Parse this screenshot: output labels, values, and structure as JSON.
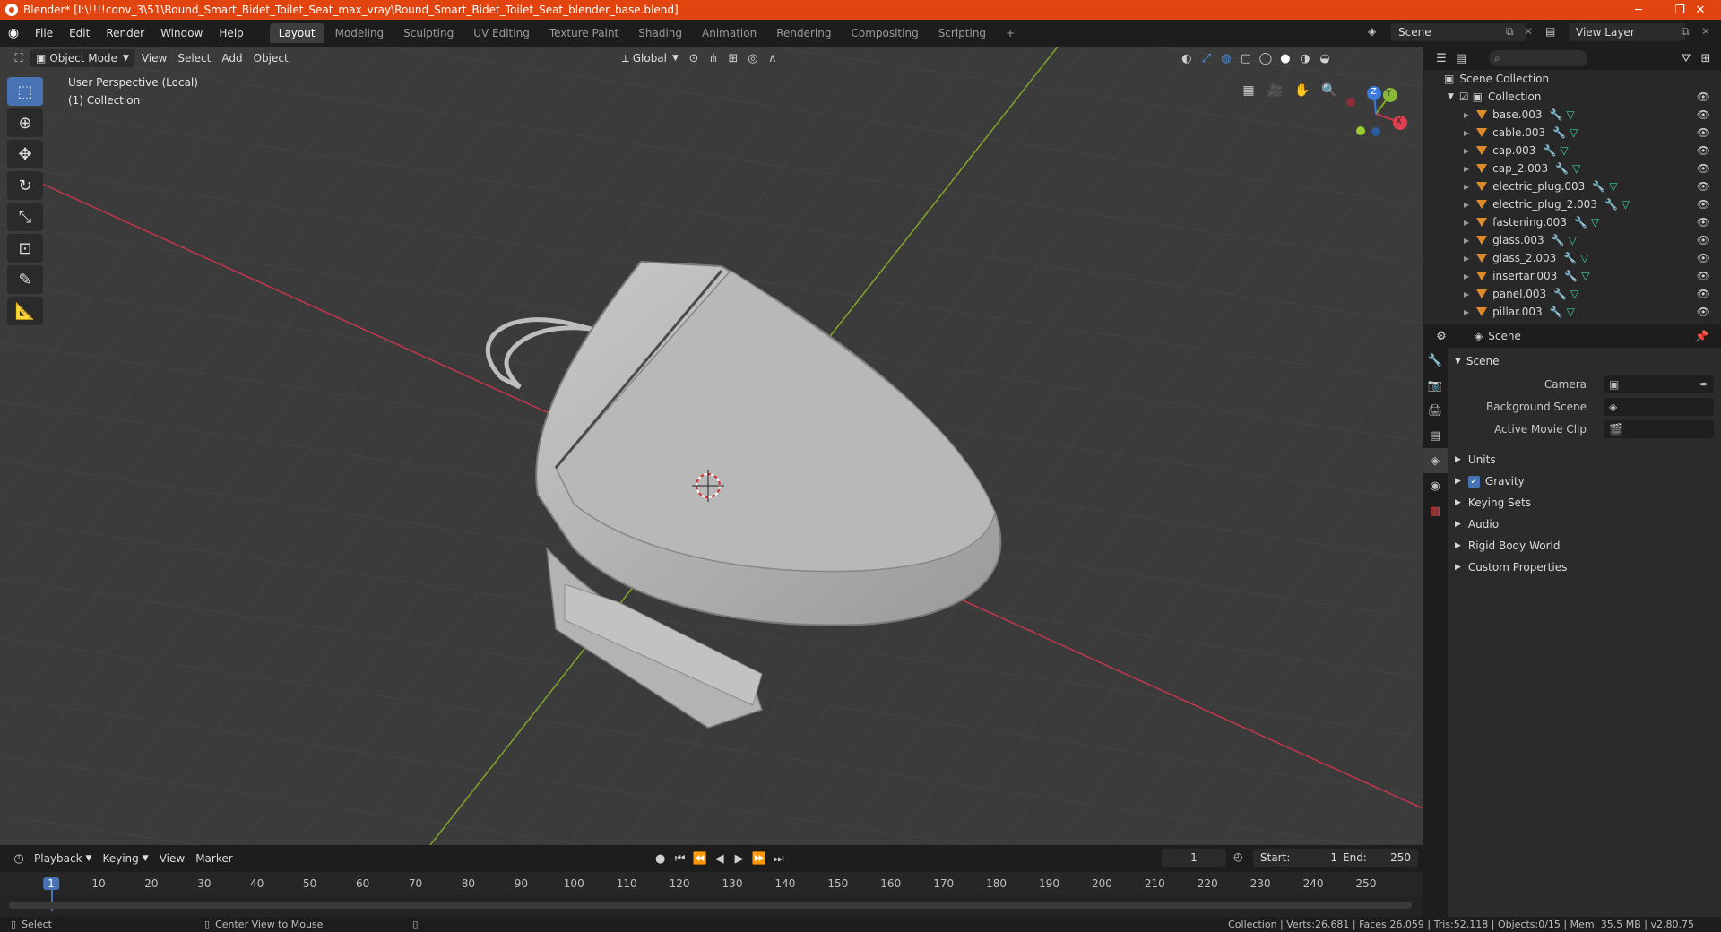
{
  "titlebar": {
    "title": "Blender* [I:\\!!!!conv_3\\51\\Round_Smart_Bidet_Toilet_Seat_max_vray\\Round_Smart_Bidet_Toilet_Seat_blender_base.blend]",
    "minimize": "─",
    "maximize": "❐",
    "close": "✕"
  },
  "menu": [
    "File",
    "Edit",
    "Render",
    "Window",
    "Help"
  ],
  "workspaces": [
    {
      "label": "Layout",
      "active": true
    },
    {
      "label": "Modeling"
    },
    {
      "label": "Sculpting"
    },
    {
      "label": "UV Editing"
    },
    {
      "label": "Texture Paint"
    },
    {
      "label": "Shading"
    },
    {
      "label": "Animation"
    },
    {
      "label": "Rendering"
    },
    {
      "label": "Compositing"
    },
    {
      "label": "Scripting"
    }
  ],
  "add_workspace": "+",
  "scene": {
    "name": "Scene"
  },
  "view_layer": {
    "name": "View Layer"
  },
  "viewport": {
    "mode": "Object Mode",
    "menus": [
      "View",
      "Select",
      "Add",
      "Object"
    ],
    "transform_orientation": "Global",
    "info_line1": "User Perspective (Local)",
    "info_line2": "(1) Collection",
    "gizmo": {
      "x": "X",
      "y": "Y",
      "z": "Z"
    }
  },
  "outliner": {
    "root": "Scene Collection",
    "collection": "Collection",
    "objects": [
      "base.003",
      "cable.003",
      "cap.003",
      "cap_2.003",
      "electric_plug.003",
      "electric_plug_2.003",
      "fastening.003",
      "glass.003",
      "glass_2.003",
      "insertar.003",
      "panel.003",
      "pillar.003"
    ]
  },
  "properties": {
    "header": "Scene",
    "section": "Scene",
    "fields": [
      {
        "label": "Camera"
      },
      {
        "label": "Background Scene"
      },
      {
        "label": "Active Movie Clip"
      }
    ],
    "panels": [
      "Units",
      "Gravity",
      "Keying Sets",
      "Audio",
      "Rigid Body World",
      "Custom Properties"
    ]
  },
  "timeline": {
    "menus": [
      "Playback",
      "Keying",
      "View",
      "Marker"
    ],
    "current_frame": "1",
    "start_label": "Start:",
    "start": "1",
    "end_label": "End:",
    "end": "250",
    "ticks": [
      "1",
      "10",
      "20",
      "30",
      "40",
      "50",
      "60",
      "70",
      "80",
      "90",
      "100",
      "110",
      "120",
      "130",
      "140",
      "150",
      "160",
      "170",
      "180",
      "190",
      "200",
      "210",
      "220",
      "230",
      "240",
      "250"
    ]
  },
  "statusbar": {
    "left1": "Select",
    "left2": "Center View to Mouse",
    "right": "Collection | Verts:26,681 | Faces:26,059 | Tris:52,118 | Objects:0/15 | Mem: 35.5 MB | v2.80.75"
  },
  "colors": {
    "accent": "#4772b3",
    "titlebar": "#e1440f",
    "x_axis": "#c4384a",
    "y_axis": "#7ea72b"
  }
}
